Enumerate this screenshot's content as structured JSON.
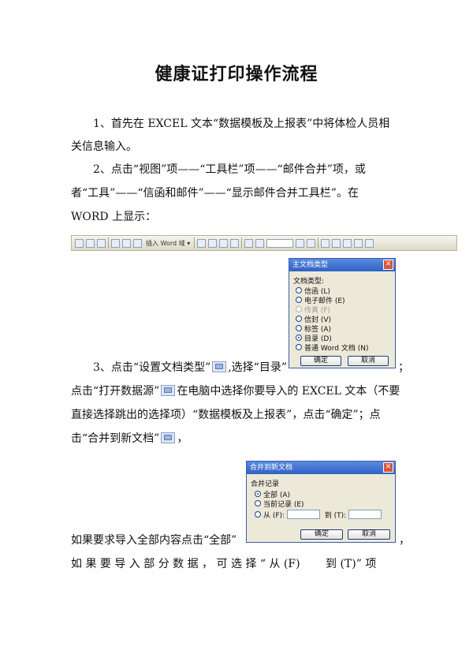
{
  "title": "健康证打印操作流程",
  "steps": {
    "s1_line1": "1、首先在 EXCEL 文本“数据模板及上报表”中将体检人员相",
    "s1_line2": "关信息输入。",
    "s2_line1": "2、点击“视图”项——“工具栏”项——“邮件合并”项，或",
    "s2_line2": "者“工具”——“信函和邮件”——“显示邮件合并工具栏”。在",
    "s2_line3": "WORD 上显示：",
    "s3_a": "3、点击“设置文档类型”",
    "s3_b": ",选择“目录”",
    "s3_c": "；",
    "s3_line2_a": "点击“打开数据源”",
    "s3_line2_b": "在电脑中选择你要导入的 EXCEL 文本（不要",
    "s3_line3": "直接选择跳出的选择项）“数据模板及上报表”，点击“确定”；点",
    "s3_line4_a": "击“合并到新文档”",
    "s3_line4_b": "，",
    "s4_line1_a": "如果要求导入全部内容点击“全部”",
    "s4_line1_b": "，",
    "s4_line2": "如 果 要 导 入 部 分 数 据 ， 可 选 择 “ 从 (F)　　 到 (T)” 项"
  },
  "toolbar": {
    "insert_word_field": "插入 Word 域 ▾"
  },
  "dialog_doc_type": {
    "title": "主文档类型",
    "group_label": "文档类型:",
    "options": [
      "信函 (L)",
      "电子邮件 (E)",
      "传真 (F)",
      "信封 (V)",
      "标签 (A)",
      "目录 (D)",
      "普通 Word 文档 (N)"
    ],
    "selected_index": 5,
    "disabled_index": 2,
    "ok": "确定",
    "cancel": "取消",
    "close": "✕"
  },
  "dialog_merge": {
    "title": "合并到新文档",
    "group_label": "合并记录",
    "opt_all": "全部 (A)",
    "opt_current": "当前记录 (E)",
    "opt_from": "从 (F):",
    "to_label": "到 (T):",
    "ok": "确定",
    "cancel": "取消",
    "close": "✕"
  }
}
